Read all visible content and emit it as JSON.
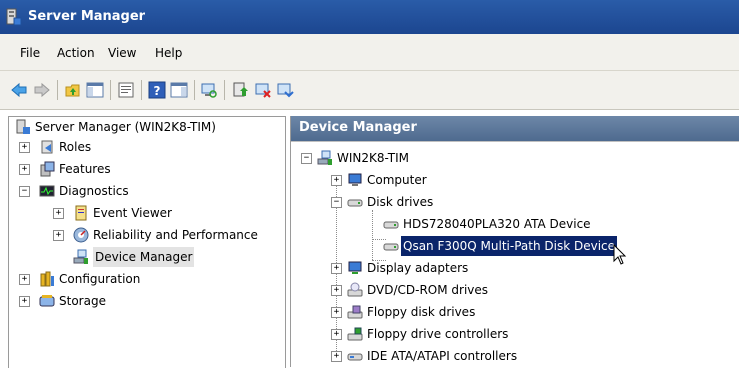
{
  "window": {
    "title": "Server Manager"
  },
  "menu": {
    "items": [
      "File",
      "Action",
      "View",
      "Help"
    ]
  },
  "toolbar": {
    "icons": [
      "back-arrow-icon",
      "forward-arrow-icon",
      "up-folder-icon",
      "show-hide-console-tree-icon",
      "properties-icon",
      "help-icon",
      "show-action-pane-icon",
      "scan-hardware-icon",
      "update-driver-icon",
      "disable-device-icon",
      "uninstall-device-icon"
    ]
  },
  "left_tree": {
    "root": "Server Manager (WIN2K8-TIM)",
    "roles": "Roles",
    "features": "Features",
    "diagnostics": "Diagnostics",
    "event_viewer": "Event Viewer",
    "reliability": "Reliability and Performance",
    "device_manager": "Device Manager",
    "configuration": "Configuration",
    "storage": "Storage"
  },
  "right_pane": {
    "header": "Device Manager",
    "root": "WIN2K8-TIM",
    "computer": "Computer",
    "disk_drives": "Disk drives",
    "disk1": "HDS728040PLA320 ATA Device",
    "disk2": "Qsan F300Q  Multi-Path Disk Device",
    "display_adapters": "Display adapters",
    "dvd": "DVD/CD-ROM drives",
    "floppy": "Floppy disk drives",
    "floppy_ctrl": "Floppy drive controllers",
    "ide": "IDE ATA/ATAPI controllers"
  },
  "colors": {
    "title_bar": "#1c4690",
    "selection": "#0a246a",
    "pane_header": "#5b7699"
  }
}
